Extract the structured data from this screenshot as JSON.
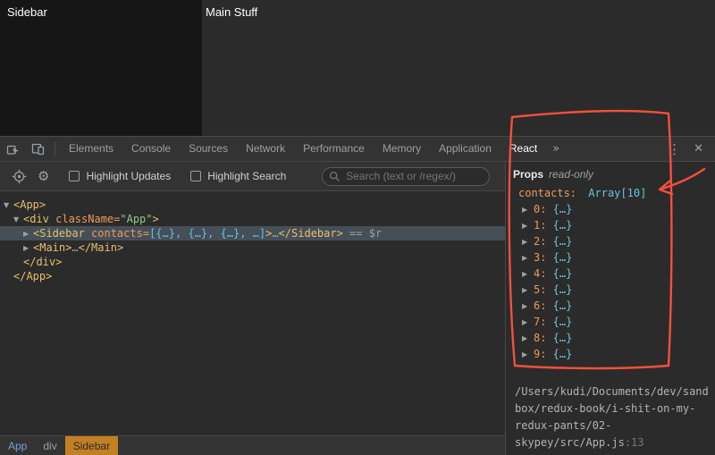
{
  "colors": {
    "annotation": "#f4503a",
    "breadcrumb_selected_bg": "#c28023",
    "tag_color": "#e8bf6a",
    "attr_color": "#ee9a5c",
    "string_color": "#8fc97f",
    "value_color": "#68c2dd"
  },
  "icons": {
    "more_tabs": "»",
    "kebab": "⋮",
    "close": "✕",
    "gear": "⚙",
    "collapsed": "▶",
    "expanded": "▼"
  },
  "page": {
    "sidebar_label": "Sidebar",
    "main_label": "Main Stuff"
  },
  "devtools": {
    "tabs": [
      "Elements",
      "Console",
      "Sources",
      "Network",
      "Performance",
      "Memory",
      "Application",
      "React"
    ],
    "active_tab": "React",
    "toolbar": {
      "highlight_updates_label": "Highlight Updates",
      "highlight_search_label": "Highlight Search",
      "search_placeholder": "Search (text or /regex/)"
    },
    "tree": {
      "rows": [
        {
          "indent": 0,
          "arrow": "▼",
          "selected": false,
          "segments": [
            {
              "t": "<App>",
              "c": "tag"
            }
          ]
        },
        {
          "indent": 1,
          "arrow": "▼",
          "selected": false,
          "segments": [
            {
              "t": "<div ",
              "c": "tag"
            },
            {
              "t": "className=",
              "c": "attr"
            },
            {
              "t": "\"App\"",
              "c": "string"
            },
            {
              "t": ">",
              "c": "tag"
            }
          ]
        },
        {
          "indent": 2,
          "arrow": "▶",
          "selected": true,
          "segments": [
            {
              "t": "<Sidebar ",
              "c": "tag"
            },
            {
              "t": "contacts=",
              "c": "attr"
            },
            {
              "t": "[{…}, {…}, {…}, …]",
              "c": "value"
            },
            {
              "t": ">",
              "c": "tag"
            },
            {
              "t": "…",
              "c": "dim"
            },
            {
              "t": "</Sidebar>",
              "c": "tag"
            },
            {
              "t": " == $r",
              "c": "dim"
            }
          ]
        },
        {
          "indent": 2,
          "arrow": "▶",
          "selected": false,
          "segments": [
            {
              "t": "<Main>",
              "c": "tag"
            },
            {
              "t": "…",
              "c": "dim"
            },
            {
              "t": "</Main>",
              "c": "tag"
            }
          ]
        },
        {
          "indent": 1,
          "arrow": "",
          "selected": false,
          "segments": [
            {
              "t": "</div>",
              "c": "tag"
            }
          ]
        },
        {
          "indent": 0,
          "arrow": "",
          "selected": false,
          "segments": [
            {
              "t": "</App>",
              "c": "tag"
            }
          ]
        }
      ]
    },
    "props": {
      "title": "Props",
      "mode": "read-only",
      "contacts_key": "contacts:",
      "contacts_value": "Array[10]",
      "items": [
        {
          "key": "0",
          "value": "{…}"
        },
        {
          "key": "1",
          "value": "{…}"
        },
        {
          "key": "2",
          "value": "{…}"
        },
        {
          "key": "3",
          "value": "{…}"
        },
        {
          "key": "4",
          "value": "{…}"
        },
        {
          "key": "5",
          "value": "{…}"
        },
        {
          "key": "6",
          "value": "{…}"
        },
        {
          "key": "7",
          "value": "{…}"
        },
        {
          "key": "8",
          "value": "{…}"
        },
        {
          "key": "9",
          "value": "{…}"
        }
      ]
    },
    "source_link": {
      "path": "/Users/kudi/Documents/dev/sandbox/redux-book/i-shit-on-my-redux-pants/02-skypey/src/App.js",
      "line": ":13"
    },
    "breadcrumbs": [
      {
        "label": "App",
        "style": "component"
      },
      {
        "label": "div",
        "style": "dom"
      },
      {
        "label": "Sidebar",
        "style": "selected"
      }
    ]
  }
}
